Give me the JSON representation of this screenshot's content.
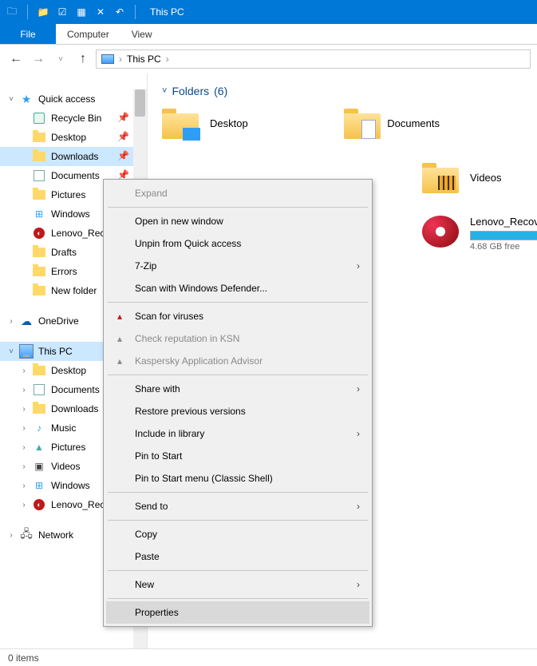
{
  "titlebar": {
    "title": "This PC",
    "qat": [
      {
        "name": "folder-icon",
        "glyph": "📁"
      },
      {
        "name": "properties-icon",
        "glyph": "☑"
      },
      {
        "name": "new-folder-icon",
        "glyph": "▦"
      },
      {
        "name": "close-icon",
        "glyph": "✕"
      },
      {
        "name": "undo-icon",
        "glyph": "↶"
      }
    ]
  },
  "ribbon": {
    "file": "File",
    "tabs": [
      "Computer",
      "View"
    ]
  },
  "address": {
    "location": "This PC"
  },
  "tree": {
    "quick_access": {
      "label": "Quick access",
      "items": [
        {
          "label": "Recycle Bin",
          "pin": true,
          "icon": "recycle"
        },
        {
          "label": "Desktop",
          "pin": true,
          "icon": "folder"
        },
        {
          "label": "Downloads",
          "pin": true,
          "icon": "folder",
          "selected": true
        },
        {
          "label": "Documents",
          "pin": true,
          "icon": "docs"
        },
        {
          "label": "Pictures",
          "pin": true,
          "icon": "folder"
        },
        {
          "label": "Windows",
          "pin": true,
          "icon": "win"
        },
        {
          "label": "Lenovo_Recovery",
          "pin": true,
          "icon": "lenovo"
        },
        {
          "label": "Drafts",
          "pin": false,
          "icon": "folder"
        },
        {
          "label": "Errors",
          "pin": false,
          "icon": "folder"
        },
        {
          "label": "New folder",
          "pin": false,
          "icon": "folder"
        }
      ]
    },
    "onedrive": {
      "label": "OneDrive"
    },
    "this_pc": {
      "label": "This PC",
      "items": [
        {
          "label": "Desktop",
          "icon": "folder"
        },
        {
          "label": "Documents",
          "icon": "docs"
        },
        {
          "label": "Downloads",
          "icon": "folder"
        },
        {
          "label": "Music",
          "icon": "music"
        },
        {
          "label": "Pictures",
          "icon": "pic"
        },
        {
          "label": "Videos",
          "icon": "video"
        },
        {
          "label": "Windows",
          "icon": "win"
        },
        {
          "label": "Lenovo_Recovery",
          "icon": "lenovo"
        }
      ]
    },
    "network": {
      "label": "Network"
    }
  },
  "content": {
    "group": "Folders",
    "group_count": "(6)",
    "folders": [
      {
        "label": "Desktop",
        "overlay": "desktop"
      },
      {
        "label": "Documents",
        "overlay": "docs"
      },
      {
        "label": "Videos",
        "overlay": "video"
      }
    ],
    "disk": {
      "label": "Lenovo_Recovery",
      "subtext": "4.68 GB free",
      "fill_percent": 85
    }
  },
  "context_menu": {
    "groups": [
      [
        {
          "label": "Expand",
          "disabled": true
        }
      ],
      [
        {
          "label": "Open in new window"
        },
        {
          "label": "Unpin from Quick access"
        },
        {
          "label": "7-Zip",
          "submenu": true
        },
        {
          "label": "Scan with Windows Defender..."
        }
      ],
      [
        {
          "label": "Scan for viruses",
          "icon": "ksk"
        },
        {
          "label": "Check reputation in KSN",
          "icon": "ksk-gray",
          "disabled": true
        },
        {
          "label": "Kaspersky Application Advisor",
          "icon": "ksk-gray",
          "disabled": true
        }
      ],
      [
        {
          "label": "Share with",
          "submenu": true
        },
        {
          "label": "Restore previous versions"
        },
        {
          "label": "Include in library",
          "submenu": true
        },
        {
          "label": "Pin to Start"
        },
        {
          "label": "Pin to Start menu (Classic Shell)"
        }
      ],
      [
        {
          "label": "Send to",
          "submenu": true
        }
      ],
      [
        {
          "label": "Copy"
        },
        {
          "label": "Paste"
        }
      ],
      [
        {
          "label": "New",
          "submenu": true
        }
      ],
      [
        {
          "label": "Properties",
          "hover": true
        }
      ]
    ]
  },
  "statusbar": {
    "text": "0 items"
  }
}
